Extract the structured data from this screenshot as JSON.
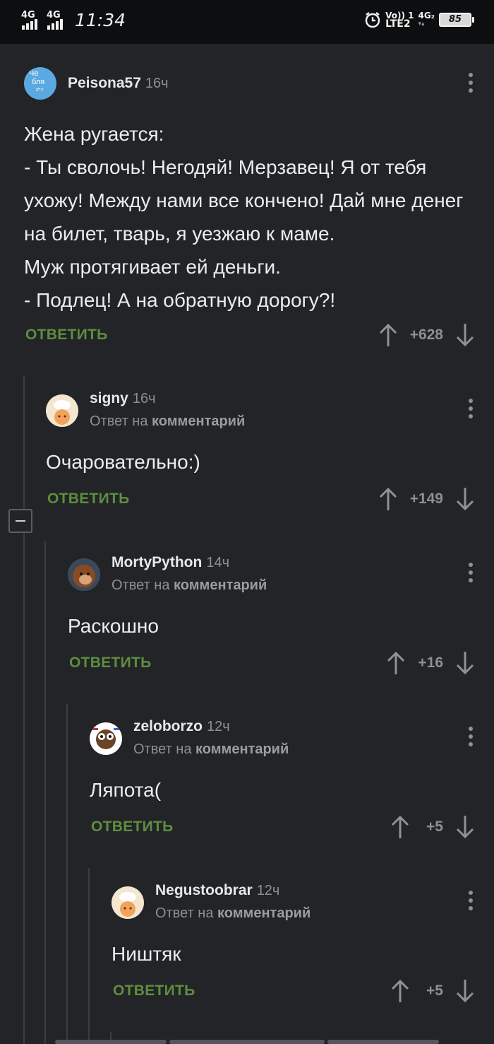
{
  "status_bar": {
    "sim1": "4G",
    "sim2": "4G",
    "time": "11:34",
    "volte_top": "Vo)) 1",
    "volte_bottom": "LTE2",
    "net2": "4G₂",
    "battery": "85"
  },
  "comments": [
    {
      "user": "Peisona57",
      "time": "16ч",
      "avatar_text_top": "Че",
      "avatar_text_mid": "бля",
      "avatar_text_bottom": "#*>",
      "body": "Жена ругается:\n- Ты сволочь! Негодяй! Мерзавец! Я от тебя ухожу! Между нами все кончено! Дай мне денег на билет, тварь, я уезжаю к маме.\nМуж протягивает ей деньги.\n- Подлец! А на обратную дорогу?!",
      "reply_label": "ОТВЕТИТЬ",
      "score": "+628"
    },
    {
      "user": "signy",
      "time": "16ч",
      "reply_to_prefix": "Ответ на",
      "reply_to_link": "комментарий",
      "body": "Очаровательно:)",
      "reply_label": "ОТВЕТИТЬ",
      "score": "+149"
    },
    {
      "user": "MortyPython",
      "time": "14ч",
      "reply_to_prefix": "Ответ на",
      "reply_to_link": "комментарий",
      "body": "Раскошно",
      "reply_label": "ОТВЕТИТЬ",
      "score": "+16"
    },
    {
      "user": "zeloborzo",
      "time": "12ч",
      "reply_to_prefix": "Ответ на",
      "reply_to_link": "комментарий",
      "body": "Ляпота(",
      "reply_label": "ОТВЕТИТЬ",
      "score": "+5"
    },
    {
      "user": "Negustoobrar",
      "time": "12ч",
      "reply_to_prefix": "Ответ на",
      "reply_to_link": "комментарий",
      "body": "Ништяк",
      "reply_label": "ОТВЕТИТЬ",
      "score": "+5"
    }
  ],
  "colors": {
    "background": "#222428",
    "reply_green": "#5f8d3e",
    "muted": "#8d8f93",
    "thread_line": "#3b3d42"
  }
}
